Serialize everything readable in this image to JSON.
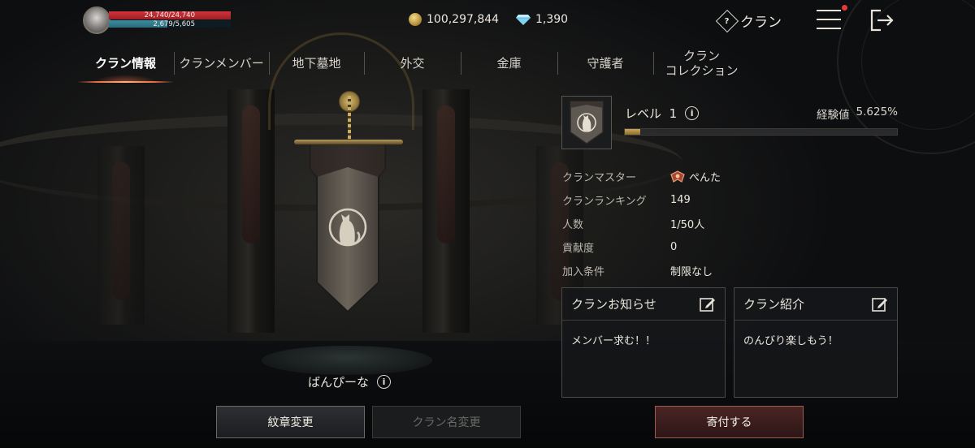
{
  "player": {
    "hp_text": "24,740/24,740",
    "hp_fraction": 1.0,
    "mp_text": "2,679/5,605",
    "mp_fraction": 0.478
  },
  "currency": {
    "gold": "100,297,844",
    "gems": "1,390"
  },
  "header": {
    "clan_label": "クラン",
    "help_glyph": "?"
  },
  "tabs": [
    {
      "label": "クラン情報",
      "active": true
    },
    {
      "label": "クランメンバー",
      "active": false
    },
    {
      "label": "地下墓地",
      "active": false
    },
    {
      "label": "外交",
      "active": false
    },
    {
      "label": "金庫",
      "active": false
    },
    {
      "label": "守護者",
      "active": false
    },
    {
      "label": "クラン\nコレクション",
      "active": false
    }
  ],
  "clan": {
    "name": "ばんぴーな",
    "level_label": "レベル",
    "level_value": "1",
    "exp_label": "経験値",
    "exp_value": "5.625%",
    "exp_fraction": 0.05625,
    "info_glyph": "i",
    "details": [
      {
        "key": "クランマスター",
        "value": "ぺんた",
        "icon": "master-crest-icon"
      },
      {
        "key": "クランランキング",
        "value": "149"
      },
      {
        "key": "人数",
        "value": "1/50人"
      },
      {
        "key": "貢献度",
        "value": "0"
      },
      {
        "key": "加入条件",
        "value": "制限なし"
      }
    ],
    "notice": {
      "title": "クランお知らせ",
      "body": "メンバー求む！！"
    },
    "intro": {
      "title": "クラン紹介",
      "body": "のんびり楽しもう！"
    }
  },
  "buttons": {
    "emblem": "紋章変更",
    "rename": "クラン名変更",
    "donate": "寄付する"
  },
  "colors": {
    "hp": "#d2343a",
    "mp": "#3b8ea3",
    "tab_accent": "#e26a45",
    "notification_dot": "#e43a3a"
  }
}
